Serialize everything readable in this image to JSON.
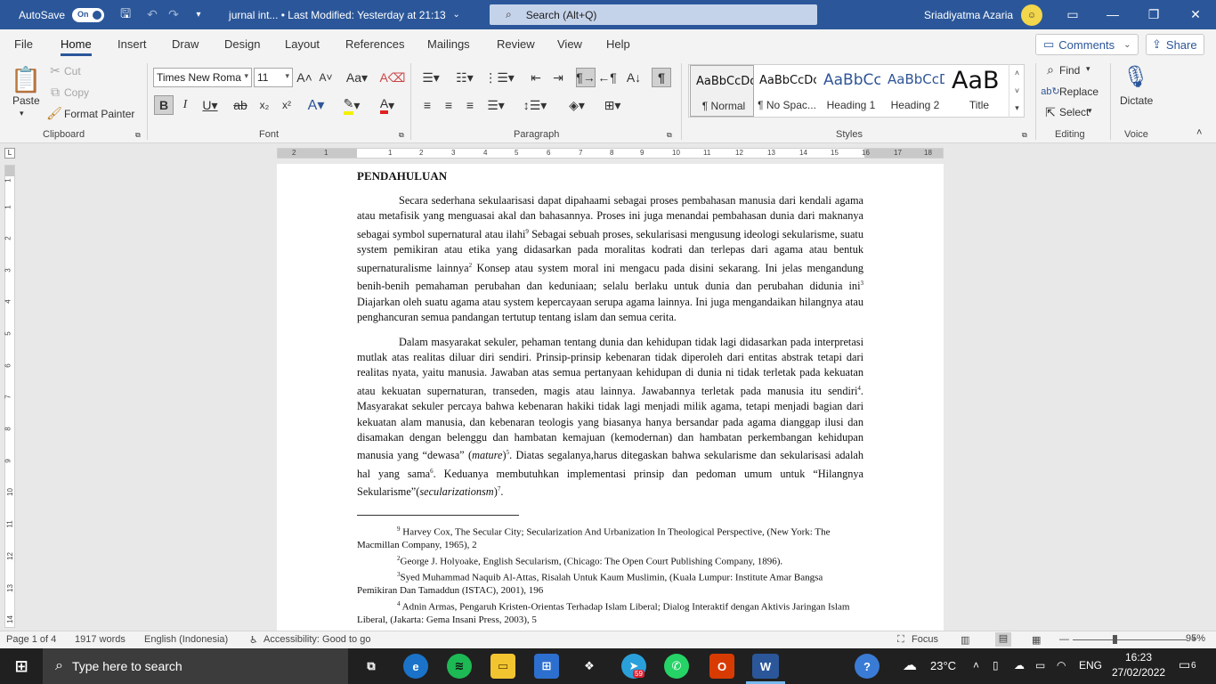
{
  "titlebar": {
    "autosave_label": "AutoSave",
    "toggle_state": "On",
    "doc_title": "jurnal int... • Last Modified: Yesterday at 21:13",
    "search_placeholder": "Search (Alt+Q)",
    "user_name": "Sriadiyatma Azaria"
  },
  "tabs": [
    "File",
    "Home",
    "Insert",
    "Draw",
    "Design",
    "Layout",
    "References",
    "Mailings",
    "Review",
    "View",
    "Help"
  ],
  "active_tab": "Home",
  "comments_label": "Comments",
  "share_label": "Share",
  "ribbon": {
    "clipboard": {
      "paste": "Paste",
      "cut": "Cut",
      "copy": "Copy",
      "format_painter": "Format Painter",
      "label": "Clipboard"
    },
    "font": {
      "family": "Times New Roma",
      "size": "11",
      "label": "Font"
    },
    "paragraph": {
      "label": "Paragraph"
    },
    "styles": {
      "items": [
        {
          "preview": "AaBbCcDc",
          "name": "¶ Normal"
        },
        {
          "preview": "AaBbCcDc",
          "name": "¶ No Spac..."
        },
        {
          "preview": "AaBbCc",
          "name": "Heading 1"
        },
        {
          "preview": "AaBbCcD",
          "name": "Heading 2"
        },
        {
          "preview": "AaB",
          "name": "Title"
        }
      ],
      "label": "Styles"
    },
    "editing": {
      "find": "Find",
      "replace": "Replace",
      "select": "Select",
      "label": "Editing"
    },
    "voice": {
      "dictate": "Dictate",
      "label": "Voice"
    }
  },
  "ruler": {
    "h_ticks": [
      "2",
      "1",
      "1",
      "2",
      "3",
      "4",
      "5",
      "6",
      "7",
      "8",
      "9",
      "10",
      "11",
      "12",
      "13",
      "14",
      "15",
      "16",
      "17",
      "18"
    ],
    "v_ticks": [
      "1",
      "1",
      "2",
      "3",
      "4",
      "5",
      "6",
      "7",
      "8",
      "9",
      "10",
      "11",
      "12",
      "13",
      "14"
    ]
  },
  "document": {
    "heading": "PENDAHULUAN",
    "p1": {
      "a": "Secara sederhana sekulaarisasi dapat dipahaami sebagai proses pembahasan manusia dari kendali agama atau metafisik yang menguasai akal dan bahasannya. Proses ini juga menandai pembahasan dunia dari maknanya sebagai symbol supernatural atau ilahi",
      "s1": "9",
      "b": " Sebagai sebuah proses, sekularisasi mengusung ideologi sekularisme, suatu system pemikiran atau etika yang didasarkan pada moralitas kodrati dan terlepas dari agama atau bentuk supernaturalisme lainnya",
      "s2": "2",
      "c": " Konsep atau system moral ini mengacu pada disini sekarang. Ini jelas mengandung benih-benih pemahaman perubahan dan keduniaan; selalu berlaku untuk dunia dan perubahan didunia ini",
      "s3": "3",
      "d": " Diajarkan oleh suatu agama atau system kepercayaan serupa agama lainnya. Ini juga mengandaikan hilangnya atau penghancuran semua pandangan tertutup tentang islam dan semua cerita."
    },
    "p2": {
      "a": "Dalam masyarakat sekuler, pehaman tentang dunia dan kehidupan tidak lagi didasarkan pada interpretasi mutlak atas realitas diluar diri sendiri. Prinsip-prinsip kebenaran tidak diperoleh dari entitas abstrak tetapi dari realitas nyata, yaitu manusia. Jawaban atas semua pertanyaan kehidupan di dunia ni tidak terletak pada kekuatan atau kekuatan supernaturan, transeden, magis atau lainnya. Jawabannya terletak pada manusia itu sendiri",
      "s4": "4",
      "b": ". Masyarakat sekuler percaya bahwa kebenaran hakiki tidak lagi menjadi milik agama, tetapi menjadi bagian dari kekuatan alam manusia, dan kebenaran teologis yang biasanya hanya bersandar pada agama dianggap ilusi dan disamakan dengan belenggu dan hambatan kemajuan (kemodernan) dan hambatan perkembangan kehidupan manusia yang “dewasa” (",
      "i1": "mature",
      "c": ")",
      "s5": "5",
      "d": ". Diatas segalanya,harus ditegaskan bahwa sekularisme dan sekularisasi adalah hal yang sama",
      "s6": "6",
      "e": ". Keduanya membutuhkan implementasi prinsip dan pedoman umum untuk “Hilangnya Sekularisme”(",
      "i2": "secularizationsm",
      "f": ")",
      "s7": "7",
      "g": "."
    },
    "footnotes": [
      {
        "num": "9",
        "text": " Harvey Cox, The Secular City; Secularization And Urbanization In Theological Perspective, (New York: The Macmillan Company, 1965), 2"
      },
      {
        "num": "2",
        "text": "George J. Holyoake, English Secularism, (Chicago: The Open Court Publishing Company, 1896)."
      },
      {
        "num": "3",
        "text": "Syed Muhammad Naquib Al-Attas, Risalah Untuk Kaum Muslimin, (Kuala Lumpur: Institute Amar Bangsa Pemikiran Dan Tamaddun (ISTAC), 2001), 196"
      },
      {
        "num": "4",
        "text": " Adnin Armas, Pengaruh Kristen-Orientas Terhadap Islam Liberal; Dialog Interaktif dengan Aktivis Jaringan Islam Liberal, (Jakarta: Gema Insani Press, 2003), 5"
      }
    ]
  },
  "statusbar": {
    "page": "Page 1 of 4",
    "words": "1917 words",
    "language": "English (Indonesia)",
    "accessibility": "Accessibility: Good to go",
    "focus": "Focus",
    "zoom_value": 95,
    "zoom": "95%"
  },
  "taskbar": {
    "search_placeholder": "Type here to search",
    "telegram_badge": "59",
    "weather": "23°C",
    "lang": "ENG",
    "time": "16:23",
    "date": "27/02/2022",
    "notif_count": "6"
  },
  "colors": {
    "word_blue": "#2b579a",
    "taskbar": "#202020",
    "search_box": "#c5d3ea"
  }
}
